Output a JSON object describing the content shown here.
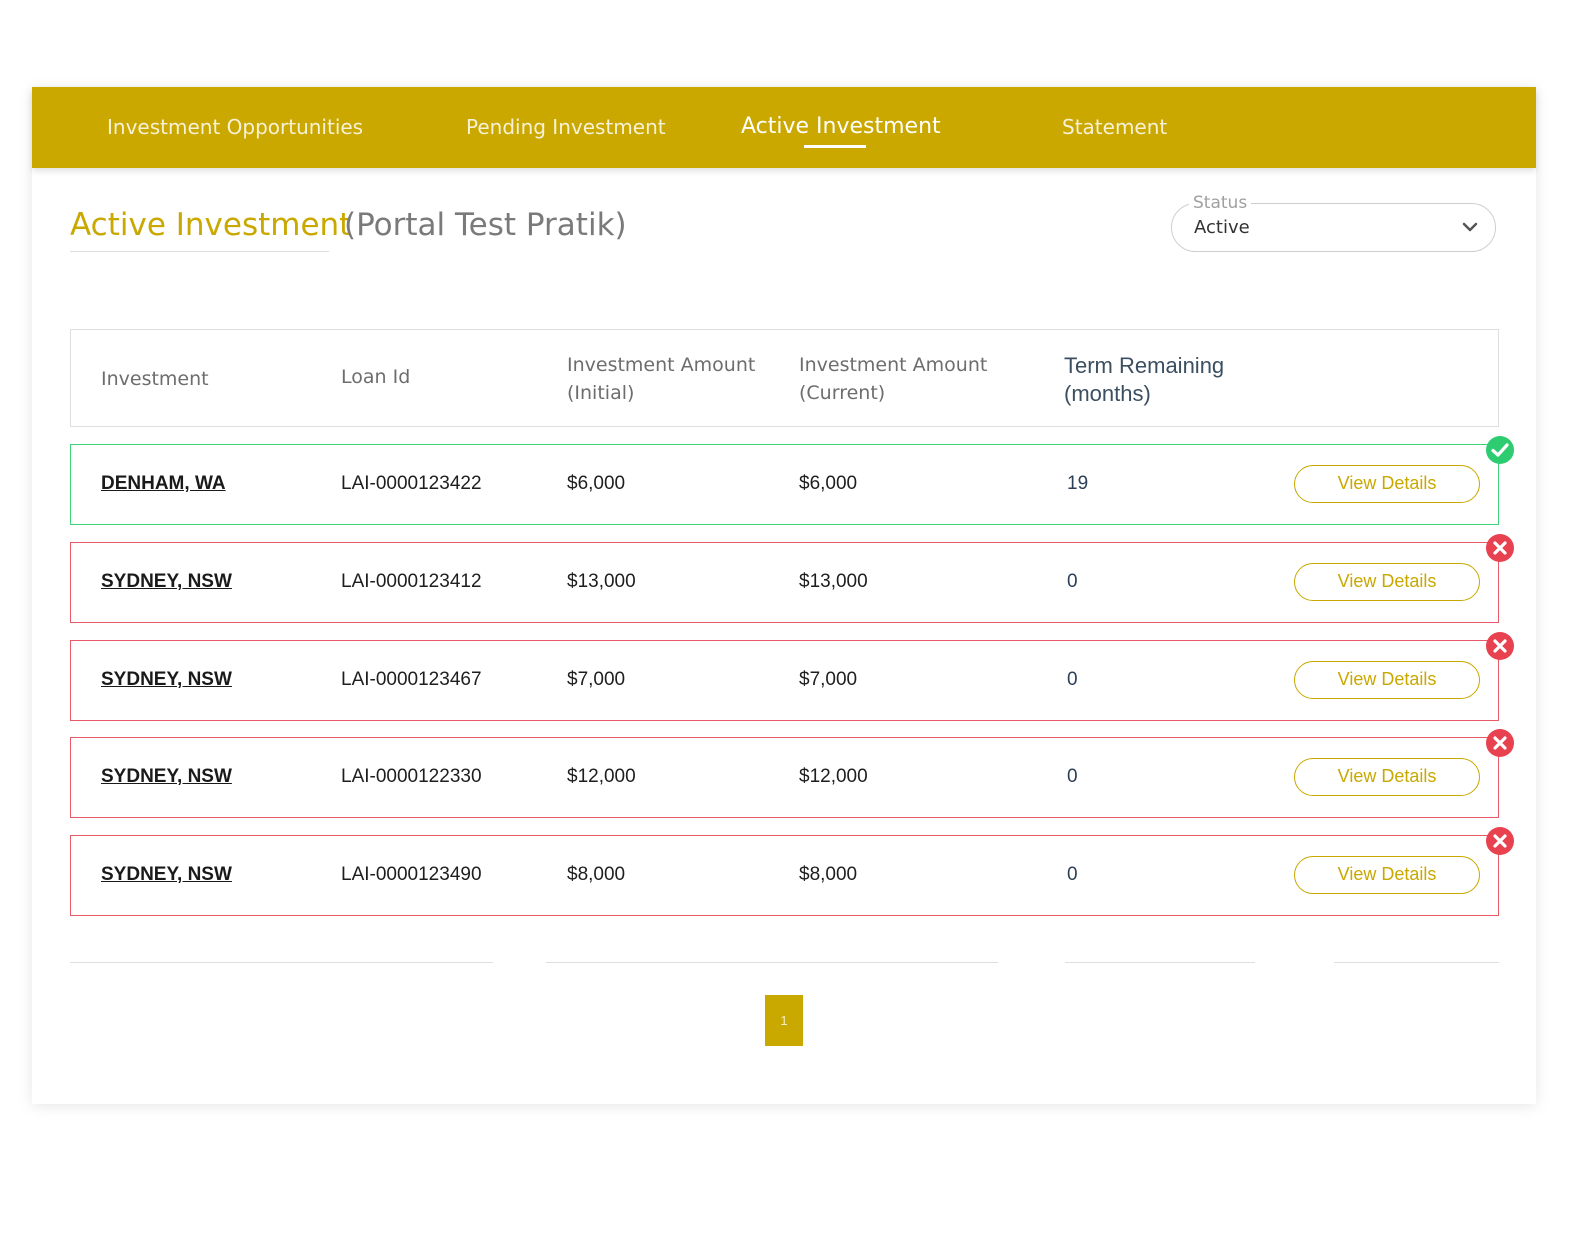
{
  "nav": {
    "tabs": [
      {
        "label": "Investment Opportunities"
      },
      {
        "label": "Pending Investment"
      },
      {
        "label": "Active Investment"
      },
      {
        "label": "Statement"
      }
    ],
    "active_tab": "Active Investment"
  },
  "header": {
    "title": "Active Investment",
    "subtitle": "(Portal Test Pratik)"
  },
  "status_filter": {
    "legend": "Status",
    "value": "Active"
  },
  "table": {
    "columns": {
      "investment": "Investment",
      "loan_id": "Loan Id",
      "amount_initial_1": "Investment Amount",
      "amount_initial_2": "(Initial)",
      "amount_current_1": "Investment Amount",
      "amount_current_2": "(Current)",
      "term_1": "Term Remaining",
      "term_2": "(months)"
    },
    "rows": [
      {
        "location": "DENHAM, WA",
        "loan_id": "LAI-0000123422",
        "initial": "$6,000",
        "current": "$6,000",
        "term": "19",
        "action": "View Details",
        "status": "success"
      },
      {
        "location": "SYDNEY, NSW",
        "loan_id": "LAI-0000123412",
        "initial": "$13,000",
        "current": "$13,000",
        "term": "0",
        "action": "View Details",
        "status": "error"
      },
      {
        "location": "SYDNEY, NSW",
        "loan_id": "LAI-0000123467",
        "initial": "$7,000",
        "current": "$7,000",
        "term": "0",
        "action": "View Details",
        "status": "error"
      },
      {
        "location": "SYDNEY, NSW",
        "loan_id": "LAI-0000122330",
        "initial": "$12,000",
        "current": "$12,000",
        "term": "0",
        "action": "View Details",
        "status": "error"
      },
      {
        "location": "SYDNEY, NSW",
        "loan_id": "LAI-0000123490",
        "initial": "$8,000",
        "current": "$8,000",
        "term": "0",
        "action": "View Details",
        "status": "error"
      }
    ]
  },
  "pagination": {
    "current_page": "1"
  },
  "colors": {
    "brand_gold": "#cba800",
    "success": "#2ecc71",
    "error": "#e8414f"
  },
  "icons": {
    "row_success": "check-circle-icon",
    "row_error": "x-circle-icon",
    "select": "chevron-down-icon"
  }
}
